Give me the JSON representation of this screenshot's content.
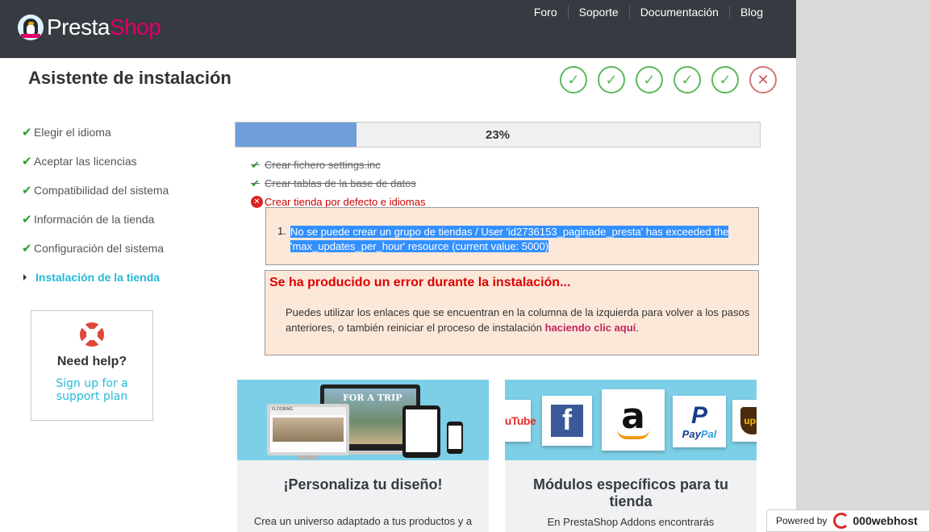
{
  "header": {
    "logo": {
      "part1": "Presta",
      "part2": "Shop"
    },
    "nav": [
      "Foro",
      "Soporte",
      "Documentación",
      "Blog"
    ]
  },
  "page_title": "Asistente de instalación",
  "step_icons": [
    {
      "state": "done",
      "glyph": "✓"
    },
    {
      "state": "done",
      "glyph": "✓"
    },
    {
      "state": "done",
      "glyph": "✓"
    },
    {
      "state": "done",
      "glyph": "✓"
    },
    {
      "state": "done",
      "glyph": "✓"
    },
    {
      "state": "error",
      "glyph": "✕"
    }
  ],
  "steps": [
    {
      "label": "Elegir el idioma",
      "state": "done"
    },
    {
      "label": "Aceptar las licencias",
      "state": "done"
    },
    {
      "label": "Compatibilidad del sistema",
      "state": "done"
    },
    {
      "label": "Información de la tienda",
      "state": "done"
    },
    {
      "label": "Configuración del sistema",
      "state": "done"
    },
    {
      "label": "Instalación de la tienda",
      "state": "current"
    }
  ],
  "check_glyph": "✔",
  "help": {
    "title": "Need help?",
    "link_line1": "Sign up for a",
    "link_line2": "support plan"
  },
  "progress": {
    "percent": 23,
    "label": "23%"
  },
  "tasks": [
    {
      "label": "Crear fichero settings.inc",
      "state": "done"
    },
    {
      "label": "Crear tablas de la base de datos",
      "state": "done"
    },
    {
      "label": "Crear tienda por defecto e idiomas",
      "state": "failed"
    }
  ],
  "error_detail": {
    "number": "1.",
    "line1": "No se puede crear un grupo de tiendas / User 'id2736153_paginade_presta' has exceeded the",
    "line2": "'max_updates_per_hour' resource (current value: 5000)"
  },
  "error_notice": {
    "heading": "Se ha producido un error durante la instalación...",
    "text": "Puedes utilizar los enlaces que se encuentran en la columna de la izquierda para volver a los pasos anteriores, o también reiniciar el proceso de instalación ",
    "link": "haciendo clic aquí",
    "after": "."
  },
  "cards": [
    {
      "title": "¡Personaliza tu diseño!",
      "text": "Crea un universo adaptado a tus productos y a",
      "art_text": "FOR A TRIP"
    },
    {
      "title": "Módulos específicos para tu tienda",
      "text": "En PrestaShop Addons encontrarás",
      "brands": {
        "youtube": "ouTube",
        "facebook": "f",
        "amazon": "a",
        "paypal_p": "P",
        "paypal1": "Pay",
        "paypal2": "Pal",
        "ups": "ups"
      }
    }
  ],
  "powered": {
    "prefix": "Powered by",
    "brand": "000webhost"
  },
  "colors": {
    "header_bg": "#363a41",
    "brand_pink": "#df0067",
    "accent_blue": "#25b9d7",
    "success_green": "#5cb85c",
    "error_red": "#d00000",
    "progress_fill": "#6e9fd8",
    "notice_bg": "#fce8d9"
  }
}
